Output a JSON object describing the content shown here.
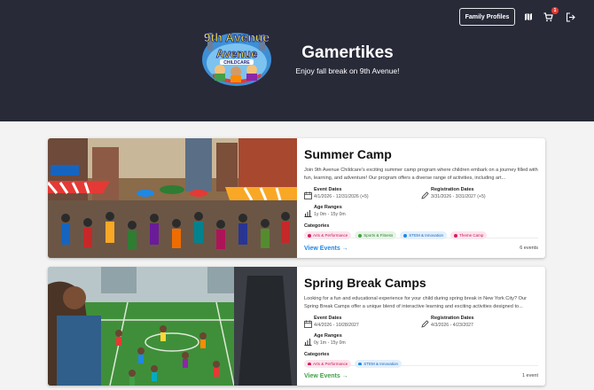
{
  "header": {
    "profiles_button": "Family Profiles",
    "cart_count": "1",
    "title": "Gamertikes",
    "subtitle": "Enjoy fall break on 9th Avenue!",
    "logo_text": "9th Avenue",
    "logo_sub": "CHILDCARE"
  },
  "cards": [
    {
      "title": "Summer Camp",
      "description": "Join 9th Avenue Childcare's exciting summer camp program where children embark on a journey filled with fun, learning, and adventure! Our program offers a diverse range of activities, including art...",
      "event_dates_label": "Event Dates",
      "event_dates": "4/1/2026 - 12/31/2026 (+5)",
      "reg_dates_label": "Registration Dates",
      "reg_dates": "3/31/2026 - 3/31/2027 (+5)",
      "age_label": "Age Ranges",
      "age_value": "1y 0m - 15y 0m",
      "categories_label": "Categories",
      "categories": [
        "Arts & Performance",
        "Sports & Fitness",
        "STEM & Innovation",
        "Theme Camp"
      ],
      "view_label": "View Events →",
      "count": "6 events"
    },
    {
      "title": "Spring Break Camps",
      "description": "Looking for a fun and educational experience for your child during spring break in New York City? Our Spring Break Camps offer a unique blend of interactive learning and exciting activities designed to...",
      "event_dates_label": "Event Dates",
      "event_dates": "4/4/2026 - 10/28/2027",
      "reg_dates_label": "Registration Dates",
      "reg_dates": "4/3/2026 - 4/23/2027",
      "age_label": "Age Ranges",
      "age_value": "0y 1m - 15y 0m",
      "categories_label": "Categories",
      "categories": [
        "Arts & Performance",
        "STEM & Innovation"
      ],
      "view_label": "View Events →",
      "count": "1 event"
    }
  ]
}
